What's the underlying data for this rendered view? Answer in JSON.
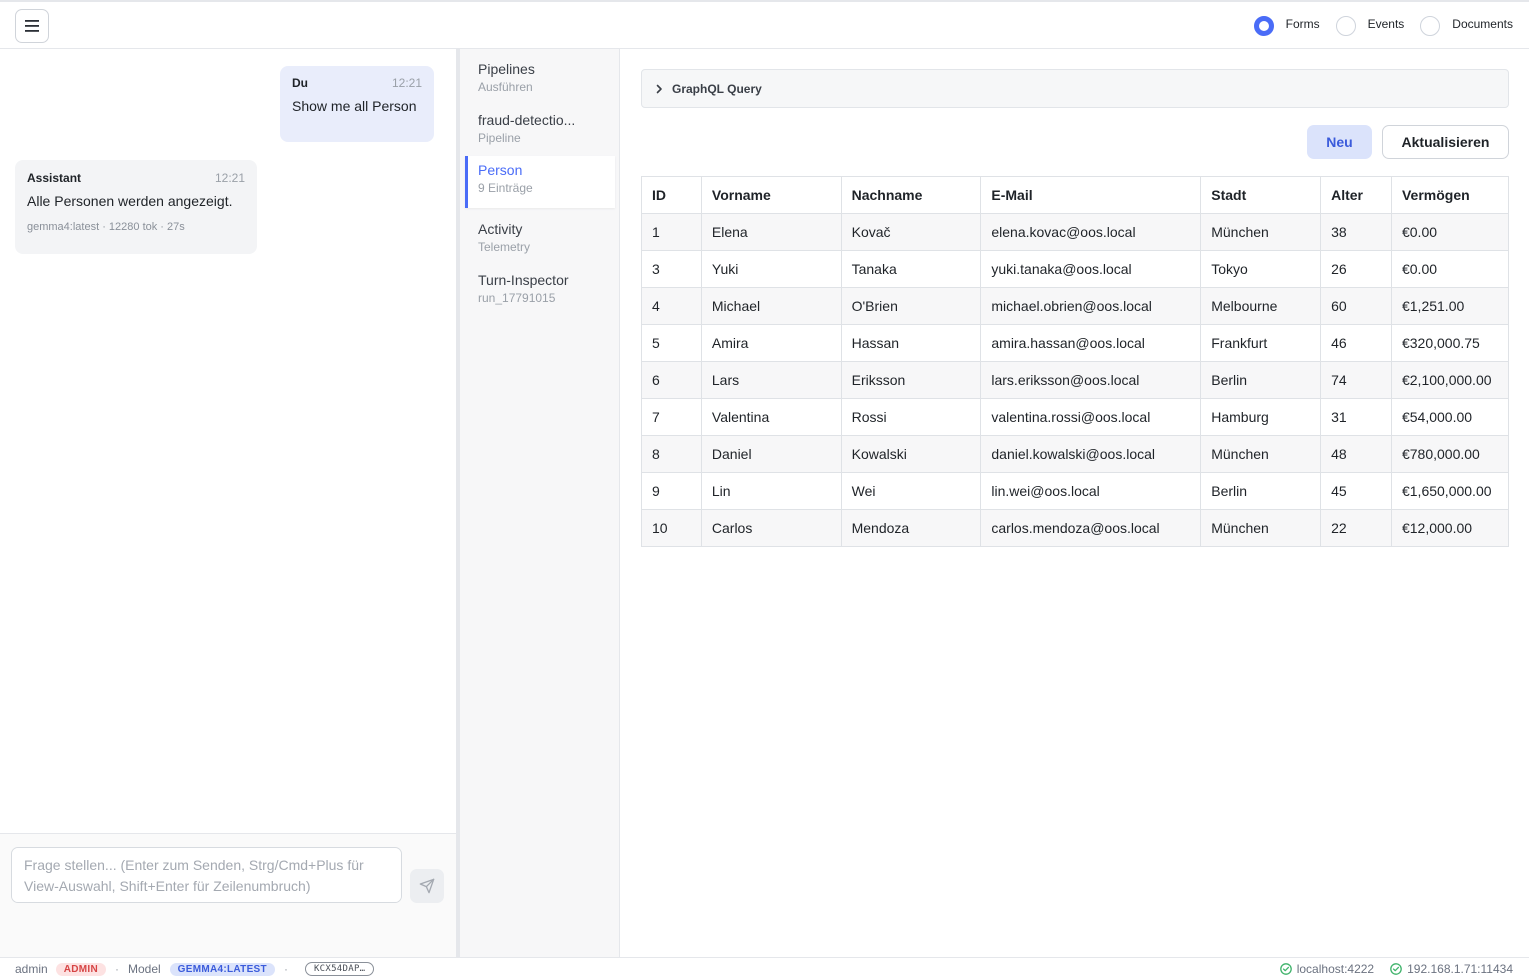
{
  "topbar": {
    "view_options": [
      {
        "label": "Forms",
        "selected": true
      },
      {
        "label": "Events",
        "selected": false
      },
      {
        "label": "Documents",
        "selected": false
      }
    ]
  },
  "chat": {
    "messages": [
      {
        "role": "Du",
        "time": "12:21",
        "text": "Show me all Person"
      },
      {
        "role": "Assistant",
        "time": "12:21",
        "text": "Alle Personen werden angezeigt.",
        "meta": "gemma4:latest · 12280 tok · 27s"
      }
    ],
    "input_placeholder": "Frage stellen... (Enter zum Senden, Strg/Cmd+Plus für View-Auswahl, Shift+Enter für Zeilenumbruch)"
  },
  "nav": {
    "items": [
      {
        "title": "Pipelines",
        "subtitle": "Ausführen",
        "active": false
      },
      {
        "title": "fraud-detectio...",
        "subtitle": "Pipeline",
        "active": false
      },
      {
        "title": "Person",
        "subtitle": "9 Einträge",
        "active": true
      },
      {
        "title": "Activity",
        "subtitle": "Telemetry",
        "active": false
      },
      {
        "title": "Turn-Inspector",
        "subtitle": "run_17791015",
        "active": false
      }
    ]
  },
  "main": {
    "graphql_label": "GraphQL Query",
    "new_label": "Neu",
    "refresh_label": "Aktualisieren",
    "table": {
      "columns": [
        "ID",
        "Vorname",
        "Nachname",
        "E-Mail",
        "Stadt",
        "Alter",
        "Vermögen"
      ],
      "rows": [
        [
          "1",
          "Elena",
          "Kovač",
          "elena.kovac@oos.local",
          "München",
          "38",
          "€0.00"
        ],
        [
          "3",
          "Yuki",
          "Tanaka",
          "yuki.tanaka@oos.local",
          "Tokyo",
          "26",
          "€0.00"
        ],
        [
          "4",
          "Michael",
          "O'Brien",
          "michael.obrien@oos.local",
          "Melbourne",
          "60",
          "€1,251.00"
        ],
        [
          "5",
          "Amira",
          "Hassan",
          "amira.hassan@oos.local",
          "Frankfurt",
          "46",
          "€320,000.75"
        ],
        [
          "6",
          "Lars",
          "Eriksson",
          "lars.eriksson@oos.local",
          "Berlin",
          "74",
          "€2,100,000.00"
        ],
        [
          "7",
          "Valentina",
          "Rossi",
          "valentina.rossi@oos.local",
          "Hamburg",
          "31",
          "€54,000.00"
        ],
        [
          "8",
          "Daniel",
          "Kowalski",
          "daniel.kowalski@oos.local",
          "München",
          "48",
          "€780,000.00"
        ],
        [
          "9",
          "Lin",
          "Wei",
          "lin.wei@oos.local",
          "Berlin",
          "45",
          "€1,650,000.00"
        ],
        [
          "10",
          "Carlos",
          "Mendoza",
          "carlos.mendoza@oos.local",
          "München",
          "22",
          "€12,000.00"
        ]
      ]
    }
  },
  "statusbar": {
    "user": "admin",
    "role_badge": "ADMIN",
    "model_label": "Model",
    "model_badge": "GEMMA4:LATEST",
    "session_badge": "KCX54DAP…",
    "connections": [
      "localhost:4222",
      "192.168.1.71:11434"
    ]
  },
  "colors": {
    "accent": "#4a6cf7",
    "ok": "#3fb36b",
    "admin_badge": "#d64545"
  }
}
